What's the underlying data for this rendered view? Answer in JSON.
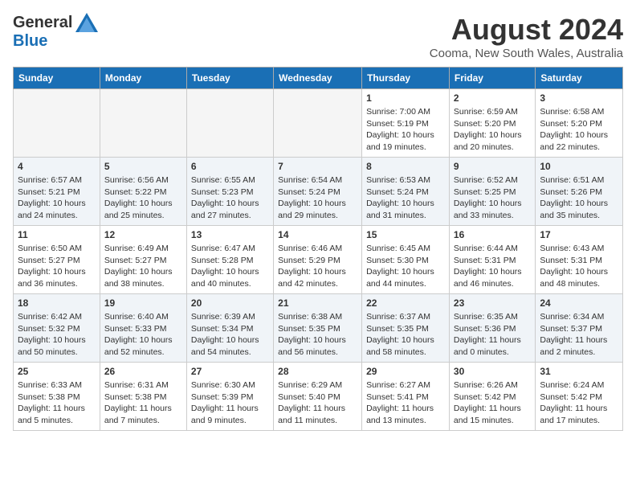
{
  "header": {
    "logo_general": "General",
    "logo_blue": "Blue",
    "month_year": "August 2024",
    "location": "Cooma, New South Wales, Australia"
  },
  "days_of_week": [
    "Sunday",
    "Monday",
    "Tuesday",
    "Wednesday",
    "Thursday",
    "Friday",
    "Saturday"
  ],
  "weeks": [
    {
      "days": [
        {
          "number": "",
          "empty": true
        },
        {
          "number": "",
          "empty": true
        },
        {
          "number": "",
          "empty": true
        },
        {
          "number": "",
          "empty": true
        },
        {
          "number": "1",
          "sunrise": "7:00 AM",
          "sunset": "5:19 PM",
          "daylight": "10 hours and 19 minutes."
        },
        {
          "number": "2",
          "sunrise": "6:59 AM",
          "sunset": "5:20 PM",
          "daylight": "10 hours and 20 minutes."
        },
        {
          "number": "3",
          "sunrise": "6:58 AM",
          "sunset": "5:20 PM",
          "daylight": "10 hours and 22 minutes."
        }
      ]
    },
    {
      "days": [
        {
          "number": "4",
          "sunrise": "6:57 AM",
          "sunset": "5:21 PM",
          "daylight": "10 hours and 24 minutes."
        },
        {
          "number": "5",
          "sunrise": "6:56 AM",
          "sunset": "5:22 PM",
          "daylight": "10 hours and 25 minutes."
        },
        {
          "number": "6",
          "sunrise": "6:55 AM",
          "sunset": "5:23 PM",
          "daylight": "10 hours and 27 minutes."
        },
        {
          "number": "7",
          "sunrise": "6:54 AM",
          "sunset": "5:24 PM",
          "daylight": "10 hours and 29 minutes."
        },
        {
          "number": "8",
          "sunrise": "6:53 AM",
          "sunset": "5:24 PM",
          "daylight": "10 hours and 31 minutes."
        },
        {
          "number": "9",
          "sunrise": "6:52 AM",
          "sunset": "5:25 PM",
          "daylight": "10 hours and 33 minutes."
        },
        {
          "number": "10",
          "sunrise": "6:51 AM",
          "sunset": "5:26 PM",
          "daylight": "10 hours and 35 minutes."
        }
      ]
    },
    {
      "days": [
        {
          "number": "11",
          "sunrise": "6:50 AM",
          "sunset": "5:27 PM",
          "daylight": "10 hours and 36 minutes."
        },
        {
          "number": "12",
          "sunrise": "6:49 AM",
          "sunset": "5:27 PM",
          "daylight": "10 hours and 38 minutes."
        },
        {
          "number": "13",
          "sunrise": "6:47 AM",
          "sunset": "5:28 PM",
          "daylight": "10 hours and 40 minutes."
        },
        {
          "number": "14",
          "sunrise": "6:46 AM",
          "sunset": "5:29 PM",
          "daylight": "10 hours and 42 minutes."
        },
        {
          "number": "15",
          "sunrise": "6:45 AM",
          "sunset": "5:30 PM",
          "daylight": "10 hours and 44 minutes."
        },
        {
          "number": "16",
          "sunrise": "6:44 AM",
          "sunset": "5:31 PM",
          "daylight": "10 hours and 46 minutes."
        },
        {
          "number": "17",
          "sunrise": "6:43 AM",
          "sunset": "5:31 PM",
          "daylight": "10 hours and 48 minutes."
        }
      ]
    },
    {
      "days": [
        {
          "number": "18",
          "sunrise": "6:42 AM",
          "sunset": "5:32 PM",
          "daylight": "10 hours and 50 minutes."
        },
        {
          "number": "19",
          "sunrise": "6:40 AM",
          "sunset": "5:33 PM",
          "daylight": "10 hours and 52 minutes."
        },
        {
          "number": "20",
          "sunrise": "6:39 AM",
          "sunset": "5:34 PM",
          "daylight": "10 hours and 54 minutes."
        },
        {
          "number": "21",
          "sunrise": "6:38 AM",
          "sunset": "5:35 PM",
          "daylight": "10 hours and 56 minutes."
        },
        {
          "number": "22",
          "sunrise": "6:37 AM",
          "sunset": "5:35 PM",
          "daylight": "10 hours and 58 minutes."
        },
        {
          "number": "23",
          "sunrise": "6:35 AM",
          "sunset": "5:36 PM",
          "daylight": "11 hours and 0 minutes."
        },
        {
          "number": "24",
          "sunrise": "6:34 AM",
          "sunset": "5:37 PM",
          "daylight": "11 hours and 2 minutes."
        }
      ]
    },
    {
      "days": [
        {
          "number": "25",
          "sunrise": "6:33 AM",
          "sunset": "5:38 PM",
          "daylight": "11 hours and 5 minutes."
        },
        {
          "number": "26",
          "sunrise": "6:31 AM",
          "sunset": "5:38 PM",
          "daylight": "11 hours and 7 minutes."
        },
        {
          "number": "27",
          "sunrise": "6:30 AM",
          "sunset": "5:39 PM",
          "daylight": "11 hours and 9 minutes."
        },
        {
          "number": "28",
          "sunrise": "6:29 AM",
          "sunset": "5:40 PM",
          "daylight": "11 hours and 11 minutes."
        },
        {
          "number": "29",
          "sunrise": "6:27 AM",
          "sunset": "5:41 PM",
          "daylight": "11 hours and 13 minutes."
        },
        {
          "number": "30",
          "sunrise": "6:26 AM",
          "sunset": "5:42 PM",
          "daylight": "11 hours and 15 minutes."
        },
        {
          "number": "31",
          "sunrise": "6:24 AM",
          "sunset": "5:42 PM",
          "daylight": "11 hours and 17 minutes."
        }
      ]
    }
  ],
  "labels": {
    "sunrise": "Sunrise:",
    "sunset": "Sunset:",
    "daylight": "Daylight:"
  }
}
